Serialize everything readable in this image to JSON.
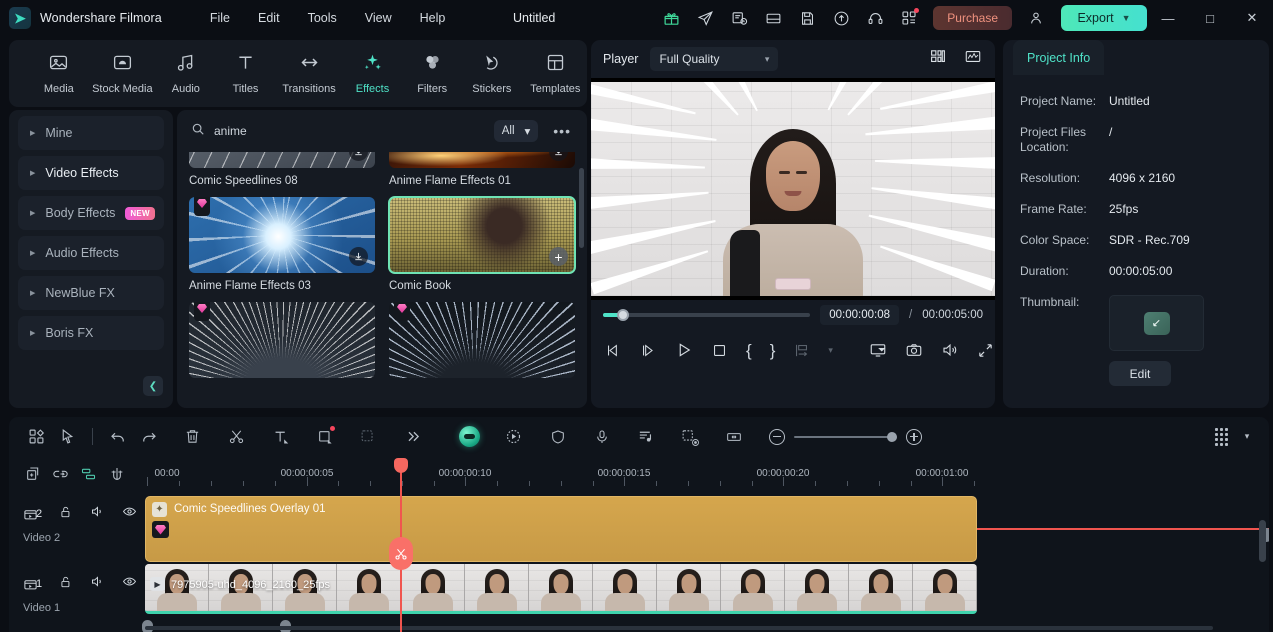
{
  "titlebar": {
    "brand": "Wondershare Filmora",
    "menus": [
      "File",
      "Edit",
      "Tools",
      "View",
      "Help"
    ],
    "doc_title": "Untitled",
    "icons": [
      "gift-icon",
      "send-icon",
      "screen-record-icon",
      "split-view-icon",
      "save-icon",
      "cloud-upload-icon",
      "headset-icon",
      "apps-grid-icon"
    ],
    "purchase_label": "Purchase",
    "account_icon": "account-icon",
    "export_label": "Export",
    "window_min": "—",
    "window_max": "□",
    "window_close": "✕"
  },
  "maintabs": [
    {
      "label": "Media",
      "icon": "media-icon",
      "active": false
    },
    {
      "label": "Stock Media",
      "icon": "stock-media-icon",
      "active": false
    },
    {
      "label": "Audio",
      "icon": "audio-icon",
      "active": false
    },
    {
      "label": "Titles",
      "icon": "titles-icon",
      "active": false
    },
    {
      "label": "Transitions",
      "icon": "transitions-icon",
      "active": false
    },
    {
      "label": "Effects",
      "icon": "effects-icon",
      "active": true
    },
    {
      "label": "Filters",
      "icon": "filters-icon",
      "active": false
    },
    {
      "label": "Stickers",
      "icon": "stickers-icon",
      "active": false
    },
    {
      "label": "Templates",
      "icon": "templates-icon",
      "active": false
    }
  ],
  "sidebar": {
    "items": [
      {
        "label": "Mine",
        "badge": ""
      },
      {
        "label": "Video Effects",
        "badge": ""
      },
      {
        "label": "Body Effects",
        "badge": "NEW"
      },
      {
        "label": "Audio Effects",
        "badge": ""
      },
      {
        "label": "NewBlue FX",
        "badge": ""
      },
      {
        "label": "Boris FX",
        "badge": ""
      }
    ],
    "collapse_icon": "chevron-left-icon"
  },
  "effects": {
    "search_value": "anime",
    "search_placeholder": "Search",
    "filter_label": "All",
    "more_label": "•••",
    "items": [
      {
        "name": "Comic Speedlines 08",
        "badge": "",
        "action": "download",
        "selected": false,
        "art": "art-speed08"
      },
      {
        "name": "Anime Flame Effects 01",
        "badge": "",
        "action": "download",
        "selected": false,
        "art": "art-flame01"
      },
      {
        "name": "Anime Flame Effects 03",
        "badge": "gem",
        "action": "download",
        "selected": false,
        "art": "art-flame03"
      },
      {
        "name": "Comic Book",
        "badge": "",
        "action": "add",
        "selected": true,
        "art": "art-comic"
      },
      {
        "name": "",
        "badge": "gem",
        "action": "",
        "selected": false,
        "art": "art-speedA"
      },
      {
        "name": "",
        "badge": "gem",
        "action": "",
        "selected": false,
        "art": "art-speedB"
      }
    ]
  },
  "player": {
    "label": "Player",
    "quality": "Full Quality",
    "layout_icon": "layout-grid-icon",
    "scope_icon": "waveform-icon",
    "current_time": "00:00:00:08",
    "separator": "/",
    "total_time": "00:00:05:00",
    "controls": [
      {
        "name": "prev-frame-button",
        "glyph": "prev"
      },
      {
        "name": "next-frame-button",
        "glyph": "next"
      },
      {
        "name": "play-button",
        "glyph": "play"
      },
      {
        "name": "stop-button",
        "glyph": "stop"
      },
      {
        "name": "mark-in-button",
        "glyph": "{"
      },
      {
        "name": "mark-out-button",
        "glyph": "}"
      },
      {
        "name": "snapshot-markers-button",
        "glyph": "markers"
      },
      {
        "name": "markers-dropdown",
        "glyph": "caret"
      },
      {
        "name": "screen-cast-button",
        "glyph": "cast"
      },
      {
        "name": "camera-snapshot-button",
        "glyph": "camera"
      },
      {
        "name": "volume-button",
        "glyph": "volume"
      },
      {
        "name": "fullscreen-button",
        "glyph": "expand"
      }
    ]
  },
  "project_info": {
    "tab_label": "Project Info",
    "fields": [
      {
        "key": "Project Name:",
        "value": "Untitled"
      },
      {
        "key": "Project Files Location:",
        "value": "/"
      },
      {
        "key": "Resolution:",
        "value": "4096 x 2160"
      },
      {
        "key": "Frame Rate:",
        "value": "25fps"
      },
      {
        "key": "Color Space:",
        "value": "SDR - Rec.709"
      },
      {
        "key": "Duration:",
        "value": "00:00:05:00"
      },
      {
        "key": "Thumbnail:",
        "value": ""
      }
    ],
    "edit_label": "Edit"
  },
  "timeline": {
    "toolbar_left": [
      {
        "name": "layouts-button",
        "icon": "four-squares-icon"
      },
      {
        "name": "select-tool-button",
        "icon": "cursor-icon"
      },
      {
        "name": "undo-button",
        "icon": "undo-icon"
      },
      {
        "name": "redo-button",
        "icon": "redo-icon"
      },
      {
        "name": "delete-button",
        "icon": "trash-icon"
      },
      {
        "name": "split-button",
        "icon": "scissors-icon"
      },
      {
        "name": "text-button",
        "icon": "text-icon"
      },
      {
        "name": "crop-button",
        "icon": "crop-square-icon"
      },
      {
        "name": "mask-button",
        "icon": "mask-icon"
      },
      {
        "name": "more-tools-button",
        "icon": "chevron-double-right-icon"
      }
    ],
    "toolbar_right": [
      {
        "name": "ai-assistant-button",
        "icon": "ai-ball-icon"
      },
      {
        "name": "auto-reframe-button",
        "icon": "dotted-play-icon"
      },
      {
        "name": "shield-button",
        "icon": "shield-icon"
      },
      {
        "name": "record-voiceover-button",
        "icon": "microphone-icon"
      },
      {
        "name": "beat-detect-button",
        "icon": "beat-icon"
      },
      {
        "name": "motion-tracking-button",
        "icon": "motion-track-icon"
      },
      {
        "name": "fit-timeline-button",
        "icon": "fit-width-icon"
      }
    ],
    "zoom_out_icon": "zoom-out-icon",
    "zoom_in_icon": "zoom-in-icon",
    "render_icon": "render-grid-icon",
    "render_caret": "▾",
    "left_buttons": [
      {
        "name": "add-track-button",
        "icon": "add-track-icon"
      },
      {
        "name": "link-clips-button",
        "icon": "link-icon"
      },
      {
        "name": "auto-ripple-button",
        "icon": "ripple-icon",
        "active": true
      },
      {
        "name": "magnet-snap-button",
        "icon": "magnet-icon"
      }
    ],
    "ruler_labels": [
      "00:00",
      "00:00:00:05",
      "00:00:00:10",
      "00:00:00:15",
      "00:00:00:20",
      "00:00:01:00"
    ],
    "tracks": [
      {
        "number": "2",
        "name": "Video 2",
        "clip_title": "Comic Speedlines Overlay 01",
        "icons": [
          "track-video-icon",
          "lock-icon",
          "mute-icon",
          "eye-icon"
        ]
      },
      {
        "number": "1",
        "name": "Video 1",
        "clip_title": "7975905-uhd_4096_2160_25fps",
        "icons": [
          "track-video-icon",
          "lock-icon",
          "mute-icon",
          "eye-icon"
        ]
      }
    ],
    "split_icon": "scissors-icon",
    "playhead_name": "playhead"
  },
  "colors": {
    "accent": "#4fe3c8",
    "playhead": "#f0554f",
    "overlay_clip": "#cb9d48",
    "purchase": "#f0927f",
    "badge_new": "#f05bd8"
  }
}
